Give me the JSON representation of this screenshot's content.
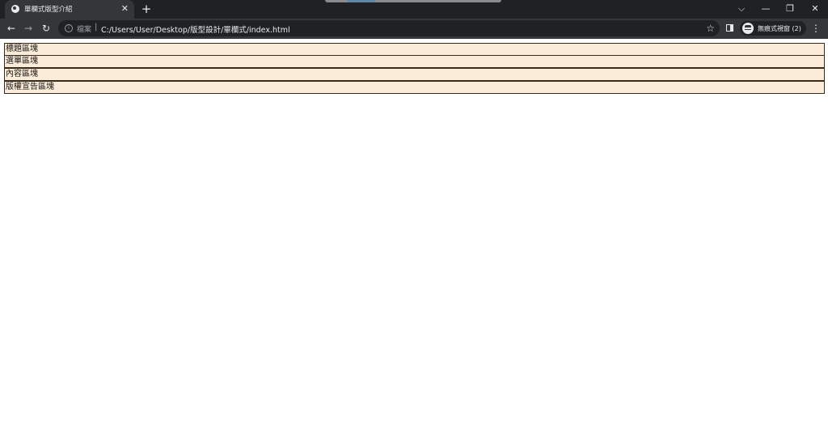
{
  "browser": {
    "tab": {
      "title": "單欄式版型介紹",
      "close_glyph": "✕",
      "favicon_icon": "globe-icon"
    },
    "new_tab_glyph": "+",
    "window_controls": {
      "dropdown_glyph": "⌵",
      "minimize_glyph": "—",
      "restore_glyph": "❐",
      "close_glyph": "✕"
    },
    "nav": {
      "back_glyph": "←",
      "forward_glyph": "→",
      "reload_glyph": "↻"
    },
    "omnibox": {
      "security_label": "檔案",
      "divider": "|",
      "url": "C:/Users/User/Desktop/版型設計/單欄式/index.html",
      "star_glyph": "☆"
    },
    "incognito_label": "無痕式視窗 (2)",
    "menu_glyph": "⋮"
  },
  "page": {
    "regions": [
      "標題區塊",
      "選單區塊",
      "內容區塊",
      "版權宣告區塊"
    ]
  },
  "colors": {
    "region_background": "#fbebd9",
    "region_border": "#3a2a1a",
    "chrome_dark": "#202124",
    "chrome_tab": "#35363a"
  }
}
